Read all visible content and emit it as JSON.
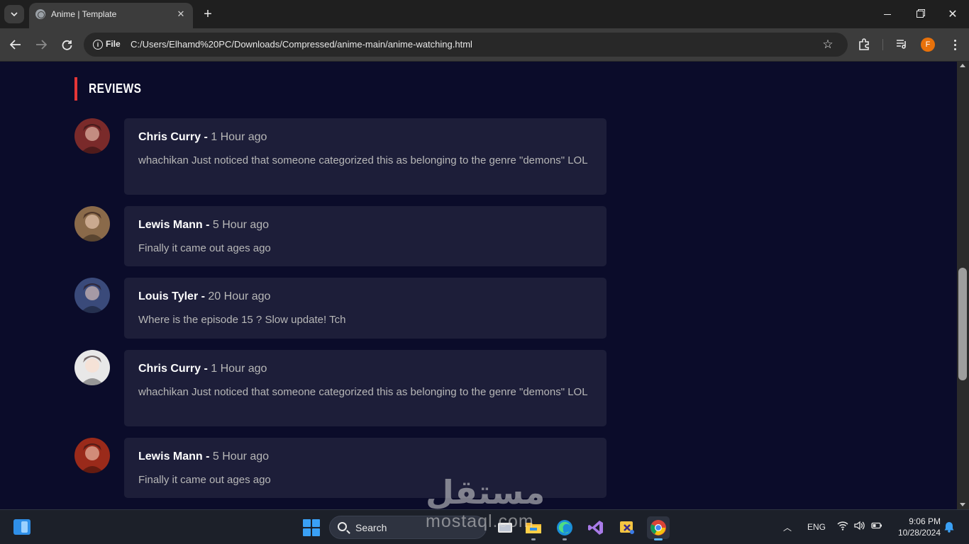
{
  "browser": {
    "tab_title": "Anime | Template",
    "scheme_label": "File",
    "url": "C:/Users/Elhamd%20PC/Downloads/Compressed/anime-main/anime-watching.html",
    "profile_initial": "F"
  },
  "page": {
    "section_title": "REVIEWS",
    "reviews": [
      {
        "name": "Chris Curry -",
        "time": "1 Hour ago",
        "text": "whachikan Just noticed that someone categorized this as belonging to the genre \"demons\" LOL",
        "avatar_color": "#7a2a2a"
      },
      {
        "name": "Lewis Mann -",
        "time": "5 Hour ago",
        "text": "Finally it came out ages ago",
        "avatar_color": "#8a6a4a"
      },
      {
        "name": "Louis Tyler -",
        "time": "20 Hour ago",
        "text": "Where is the episode 15 ? Slow update! Tch",
        "avatar_color": "#3a4a7a"
      },
      {
        "name": "Chris Curry -",
        "time": "1 Hour ago",
        "text": "whachikan Just noticed that someone categorized this as belonging to the genre \"demons\" LOL",
        "avatar_color": "#e8e8e8"
      },
      {
        "name": "Lewis Mann -",
        "time": "5 Hour ago",
        "text": "Finally it came out ages ago",
        "avatar_color": "#9a2a1a"
      }
    ]
  },
  "taskbar": {
    "search_label": "Search",
    "language": "ENG",
    "time": "9:06 PM",
    "date": "10/28/2024"
  },
  "watermark": {
    "logo_text": "مستقل",
    "site": "mostaql.com"
  },
  "colors": {
    "page_bg": "#0b0c2a",
    "card_bg": "#1d1e39",
    "accent_red": "#e53637",
    "muted_text": "#b7b7b7"
  }
}
